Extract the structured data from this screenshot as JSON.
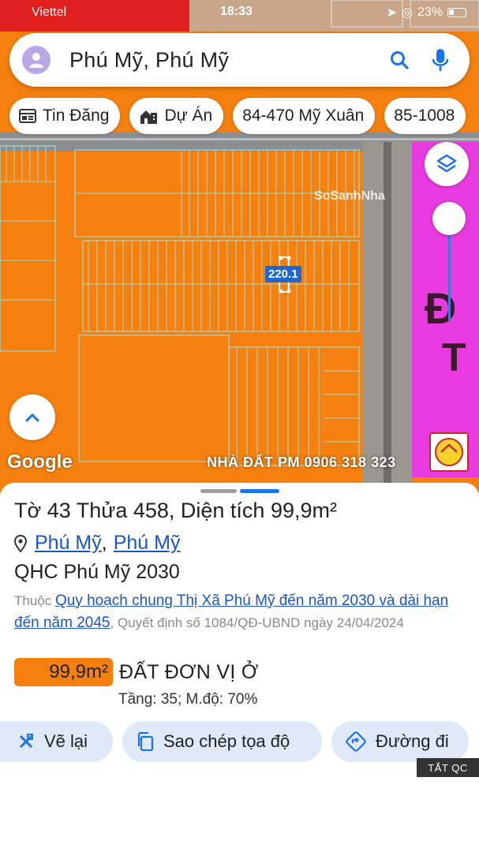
{
  "status_bar": {
    "carrier": "Viettel",
    "time": "18:33",
    "battery": "23%"
  },
  "search": {
    "query": "Phú Mỹ, Phú Mỹ"
  },
  "chips": [
    {
      "label": "Tin Đăng",
      "icon": "newspaper-icon"
    },
    {
      "label": "Dự Án",
      "icon": "building-icon"
    },
    {
      "label": "84-470 Mỹ Xuân",
      "icon": ""
    },
    {
      "label": "85-1008",
      "icon": ""
    }
  ],
  "map": {
    "lot_label": "220.1",
    "google_logo": "Google",
    "watermark": "NHÀ ĐẤT PM 0906 318 323",
    "sosanh_watermark": "SoSanhNha",
    "pmh_logo": "PMH",
    "zone_color": "#f5800e",
    "adjacent_zone_color": "#e83be0",
    "top_left_zone_color": "#e0201e"
  },
  "panel": {
    "title": "Tờ 43 Thửa 458, Diện tích 99,9m²",
    "location": {
      "part1": "Phú Mỹ",
      "part2": "Phú Mỹ"
    },
    "plan_name": "QHC Phú Mỹ 2030",
    "plan_desc_prefix": "Thuộc",
    "plan_desc_link": "Quy hoạch chung Thị Xã Phú Mỹ đến năm 2030 và dài hạn đến năm 2045",
    "plan_desc_suffix": ", Quyết định số 1084/QĐ-UBND ngày 24/04/2024",
    "zone": {
      "area": "99,9m²",
      "name": "ĐẤT ĐƠN VỊ Ở",
      "meta": "Tầng: 35; M.độ: 70%"
    },
    "actions": {
      "redraw": "Vẽ lại",
      "copy": "Sao chép tọa độ",
      "route": "Đường đi"
    },
    "ad_tag": "TẮT QC"
  }
}
